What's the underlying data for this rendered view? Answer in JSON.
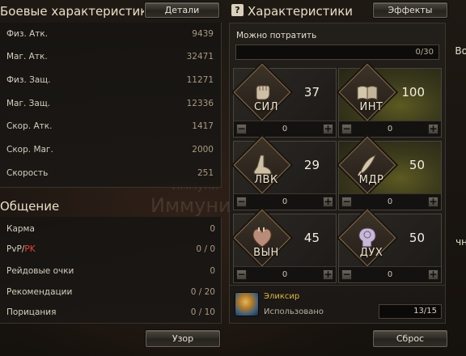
{
  "combat": {
    "title": "Боевые характеристики",
    "details_button": "Детали",
    "stats": [
      {
        "label": "Физ. Атк.",
        "value": "9439"
      },
      {
        "label": "Маг. Атк.",
        "value": "32471"
      },
      {
        "label": "Физ. Защ.",
        "value": "11271"
      },
      {
        "label": "Маг. Защ.",
        "value": "12336"
      },
      {
        "label": "Скор. Атк.",
        "value": "1417"
      },
      {
        "label": "Скор. Маг.",
        "value": "2000"
      },
      {
        "label": "Скорость",
        "value": "251"
      }
    ]
  },
  "social": {
    "title": "Общение",
    "karma_label": "Карма",
    "karma_value": "0",
    "pvp_label": "PvP/",
    "pk_label": "PK",
    "pvp_value": "0 / 0",
    "raid_label": "Рейдовые очки",
    "raid_value": "0",
    "recommend_label": "Рекомендации",
    "recommend_value": "0 / 20",
    "censure_label": "Порицания",
    "censure_value": "0 / 10",
    "pattern_button": "Узор"
  },
  "characteristics": {
    "title": "Характеристики",
    "help_glyph": "?",
    "effects_button": "Эффекты",
    "spend_label": "Можно потратить",
    "spend_value": "0/30",
    "attributes": [
      {
        "abbr": "СИЛ",
        "value": "37",
        "allocated": "0",
        "icon": "fist-icon",
        "style": "physical"
      },
      {
        "abbr": "ИНТ",
        "value": "100",
        "allocated": "0",
        "icon": "book-icon",
        "style": "mental"
      },
      {
        "abbr": "ЛВК",
        "value": "29",
        "allocated": "0",
        "icon": "foot-icon",
        "style": "physical"
      },
      {
        "abbr": "МДР",
        "value": "50",
        "allocated": "0",
        "icon": "quill-icon",
        "style": "mental"
      },
      {
        "abbr": "ВЫН",
        "value": "45",
        "allocated": "0",
        "icon": "heart-icon",
        "style": "physical"
      },
      {
        "abbr": "ДУХ",
        "value": "50",
        "allocated": "0",
        "icon": "head-icon",
        "style": "physical"
      }
    ],
    "elixir_name": "Эликсир",
    "elixir_used_label": "Использовано",
    "elixir_used_value": "13/15",
    "reset_button": "Сброс"
  },
  "background": {
    "text_1": "Иммуни",
    "text_2": "Иммуни",
    "edge_1": "Во",
    "edge_2": "чн"
  },
  "colors": {
    "accent_gold": "#e0b84a",
    "pk_red": "#e0453c",
    "mental_tile": "#5d5a22"
  }
}
